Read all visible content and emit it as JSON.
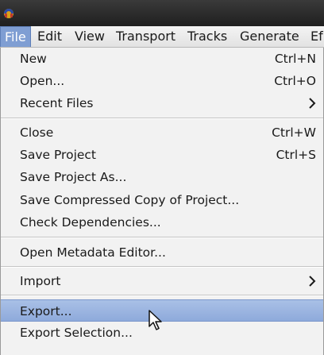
{
  "menubar": {
    "items": [
      {
        "label": "File",
        "active": true
      },
      {
        "label": "Edit"
      },
      {
        "label": "View"
      },
      {
        "label": "Transport"
      },
      {
        "label": "Tracks"
      },
      {
        "label": "Generate"
      },
      {
        "label": "Ef"
      }
    ]
  },
  "file_menu": {
    "items": [
      {
        "label": "New",
        "shortcut": "Ctrl+N"
      },
      {
        "label": "Open...",
        "shortcut": "Ctrl+O"
      },
      {
        "label": "Recent Files",
        "submenu": true
      },
      {
        "label": "Close",
        "shortcut": "Ctrl+W"
      },
      {
        "label": "Save Project",
        "shortcut": "Ctrl+S"
      },
      {
        "label": "Save Project As..."
      },
      {
        "label": "Save Compressed Copy of Project..."
      },
      {
        "label": "Check Dependencies..."
      },
      {
        "label": "Open Metadata Editor..."
      },
      {
        "label": "Import",
        "submenu": true
      },
      {
        "label": "Export...",
        "highlighted": true
      },
      {
        "label": "Export Selection..."
      }
    ]
  },
  "colors": {
    "highlight": "#8eaadb",
    "menubar_active": "#7f9ed3",
    "menu_background": "#f2f2f2"
  },
  "icons": {
    "app": "audacity-icon",
    "submenu": "chevron-right-icon",
    "pointer": "mouse-pointer-icon"
  }
}
